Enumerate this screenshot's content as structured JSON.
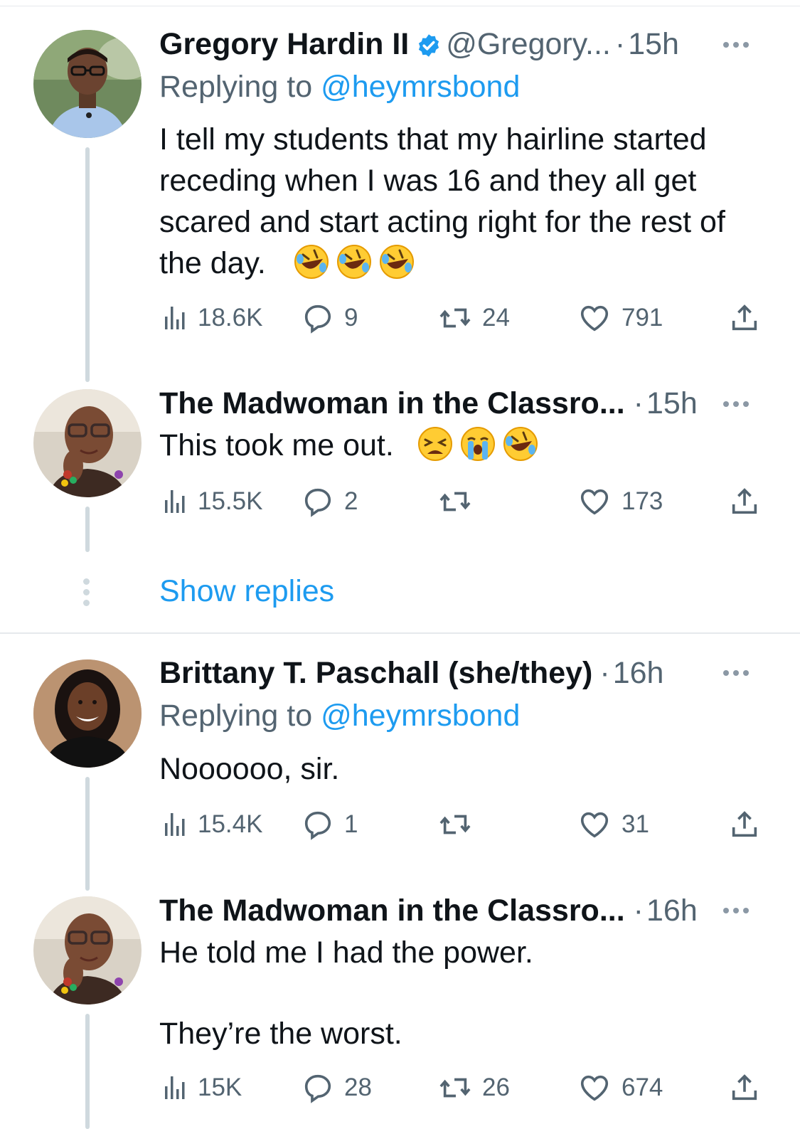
{
  "thread": {
    "show_replies_label": "Show replies",
    "tweets": [
      {
        "name": "Gregory Hardin II",
        "verified": true,
        "handle": "@Gregory...",
        "sep": "·",
        "time": "15h",
        "replying_prefix": "Replying to",
        "replying_handle": "@heymrsbond",
        "text": "I tell my students that my hairline started receding when I was 16 and they all get scared and start acting right for the rest of the day.",
        "emojis": [
          "rolling-on-floor-laughing-emoji",
          "rolling-on-floor-laughing-emoji",
          "rolling-on-floor-laughing-emoji"
        ],
        "views": "18.6K",
        "replies": "9",
        "retweets": "24",
        "likes": "791"
      },
      {
        "name": "The Madwoman in the Classro...",
        "sep": "·",
        "time": "15h",
        "text": "This took me out.",
        "emojis": [
          "weary-face-emoji",
          "loudly-crying-face-emoji",
          "rolling-on-floor-laughing-emoji"
        ],
        "views": "15.5K",
        "replies": "2",
        "retweets": "",
        "likes": "173"
      },
      {
        "name": "Brittany T. Paschall (she/they)",
        "sep": "·",
        "time": "16h",
        "replying_prefix": "Replying to",
        "replying_handle": "@heymrsbond",
        "text": "Noooooo, sir.",
        "views": "15.4K",
        "replies": "1",
        "retweets": "",
        "likes": "31"
      },
      {
        "name": "The Madwoman in the Classro...",
        "sep": "·",
        "time": "16h",
        "text_line1": "He told me I had the power.",
        "text_line2": "They’re the worst.",
        "views": "15K",
        "replies": "28",
        "retweets": "26",
        "likes": "674"
      }
    ]
  },
  "colors": {
    "link": "#1d9bf0",
    "muted": "#536471",
    "text": "#0f1419",
    "thread_line": "#cfd9de"
  }
}
